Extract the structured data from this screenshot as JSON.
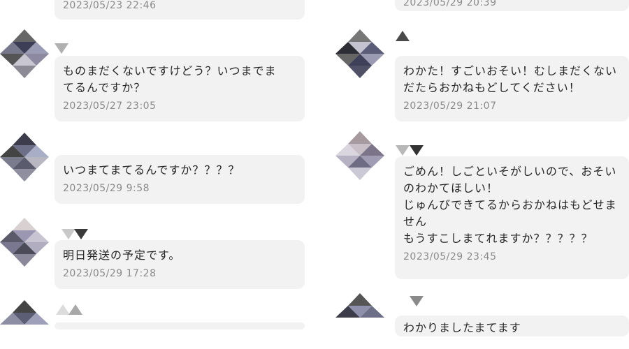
{
  "left_messages": [
    {
      "text": "",
      "time": "2023/05/23 22:46"
    },
    {
      "text": "ものまだくないですけどう？いつまでま\nてるんですか？",
      "time": "2023/05/27 23:05"
    },
    {
      "text": "いつまてまてるんですか？？？？",
      "time": "2023/05/29 9:58"
    },
    {
      "text": "明日発送の予定です。",
      "time": "2023/05/29 17:28"
    },
    {
      "text": "",
      "time": ""
    }
  ],
  "right_messages": [
    {
      "text": "",
      "time": "2023/05/29 20:39"
    },
    {
      "text": "わかた！すごいおそい！むしまだくない\nだたらおかねもどしてください！",
      "time": "2023/05/29 21:07"
    },
    {
      "text": "ごめん！しごといそがしいので、おそい\nのわかてほしい！\nじゅんびできてるからおかねはもどせま\nせん\nもうすこしまてれますか？？？？？",
      "time": "2023/05/29 23:45"
    },
    {
      "text": "わかりましたまてます",
      "time": ""
    }
  ],
  "colors": {
    "bubble": "#f2f2f2",
    "time": "#8a8a8a",
    "text": "#262626"
  }
}
